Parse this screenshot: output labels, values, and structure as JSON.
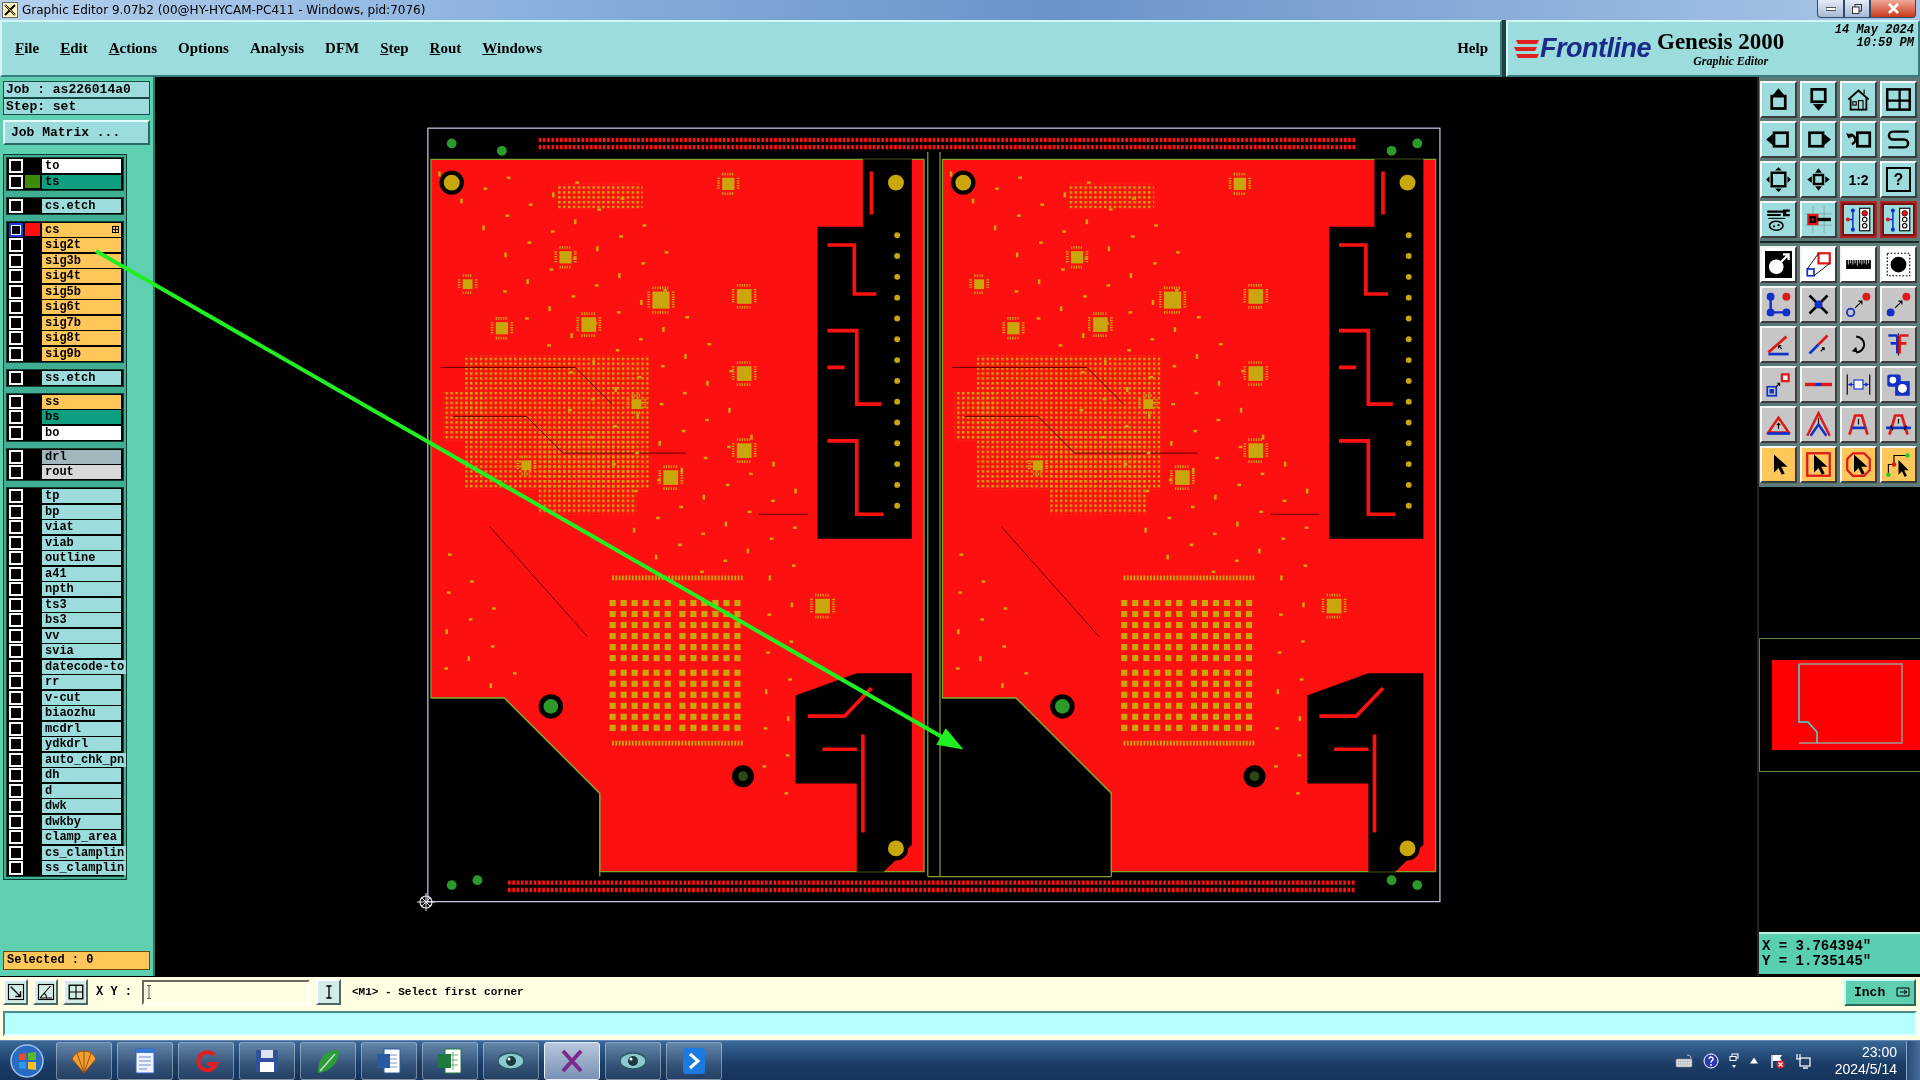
{
  "window": {
    "title": "Graphic Editor 9.07b2 (00@HY-HYCAM-PC411 - Windows, pid:7076)"
  },
  "menu": {
    "items": [
      {
        "label": "File",
        "mnemonic": true
      },
      {
        "label": "Edit",
        "mnemonic": true
      },
      {
        "label": "Actions",
        "mnemonic": true
      },
      {
        "label": "Options",
        "mnemonic": false
      },
      {
        "label": "Analysis",
        "mnemonic": false
      },
      {
        "label": "DFM",
        "mnemonic": false
      },
      {
        "label": "Step",
        "mnemonic": true
      },
      {
        "label": "Rout",
        "mnemonic": true
      },
      {
        "label": "Windows",
        "mnemonic": true
      }
    ],
    "help": "Help"
  },
  "brand": {
    "logo": "Frontline",
    "product": "Genesis 2000",
    "subtitle": "Graphic Editor",
    "date": "14 May 2024",
    "time": "10:59 PM"
  },
  "job": {
    "job": "Job : as226014a0",
    "step": "Step: set",
    "matrix_button": "Job Matrix ..."
  },
  "layer_groups": [
    {
      "layers": [
        {
          "name": "to",
          "color": "#ffffff",
          "work": false
        },
        {
          "name": "ts",
          "color": "#0e9e80",
          "display": {
            "color": "#3c8c0a"
          },
          "work": false
        }
      ]
    },
    {
      "layers": [
        {
          "name": "cs.etch",
          "color": "#9ddcdc",
          "work": false
        }
      ]
    },
    {
      "layers": [
        {
          "name": "cs",
          "color": "#ffc65a",
          "display": {
            "color": "#ff1010"
          },
          "work": true
        },
        {
          "name": "sig2t",
          "color": "#ffc65a",
          "work": false
        },
        {
          "name": "sig3b",
          "color": "#ffc65a",
          "work": false
        },
        {
          "name": "sig4t",
          "color": "#ffc65a",
          "work": false
        },
        {
          "name": "sig5b",
          "color": "#ffc65a",
          "work": false
        },
        {
          "name": "sig6t",
          "color": "#ffc65a",
          "work": false
        },
        {
          "name": "sig7b",
          "color": "#ffc65a",
          "work": false
        },
        {
          "name": "sig8t",
          "color": "#ffc65a",
          "work": false
        },
        {
          "name": "sig9b",
          "color": "#ffc65a",
          "work": false
        }
      ]
    },
    {
      "layers": [
        {
          "name": "ss.etch",
          "color": "#9ddcdc",
          "work": false
        }
      ]
    },
    {
      "layers": [
        {
          "name": "ss",
          "color": "#ffc65a",
          "work": false
        },
        {
          "name": "bs",
          "color": "#0e9e80",
          "work": false
        },
        {
          "name": "bo",
          "color": "#ffffff",
          "work": false
        }
      ]
    },
    {
      "layers": [
        {
          "name": "drl",
          "color": "#a2b6be",
          "work": false
        },
        {
          "name": "rout",
          "color": "#d8d8d8",
          "work": false
        }
      ]
    },
    {
      "layers": [
        {
          "name": "tp",
          "color": "#9ddcdc",
          "work": false
        },
        {
          "name": "bp",
          "color": "#9ddcdc",
          "work": false
        },
        {
          "name": "viat",
          "color": "#9ddcdc",
          "work": false
        },
        {
          "name": "viab",
          "color": "#9ddcdc",
          "work": false
        },
        {
          "name": "outline",
          "color": "#9ddcdc",
          "work": false
        },
        {
          "name": "a41",
          "color": "#9ddcdc",
          "work": false
        },
        {
          "name": "npth",
          "color": "#9ddcdc",
          "work": false
        },
        {
          "name": "ts3",
          "color": "#9ddcdc",
          "work": false
        },
        {
          "name": "bs3",
          "color": "#9ddcdc",
          "work": false
        },
        {
          "name": "vv",
          "color": "#9ddcdc",
          "work": false
        },
        {
          "name": "svia",
          "color": "#9ddcdc",
          "work": false
        },
        {
          "name": "datecode-to",
          "color": "#9ddcdc",
          "work": false
        },
        {
          "name": "rr",
          "color": "#9ddcdc",
          "work": false
        },
        {
          "name": "v-cut",
          "color": "#9ddcdc",
          "work": false
        },
        {
          "name": "biaozhu",
          "color": "#9ddcdc",
          "work": false
        },
        {
          "name": "mcdrl",
          "color": "#9ddcdc",
          "work": false
        },
        {
          "name": "ydkdrl",
          "color": "#9ddcdc",
          "work": false
        },
        {
          "name": "auto_chk_pn",
          "color": "#9ddcdc",
          "work": false
        },
        {
          "name": "dh",
          "color": "#9ddcdc",
          "work": false
        },
        {
          "name": "d",
          "color": "#9ddcdc",
          "work": false
        },
        {
          "name": "dwk",
          "color": "#9ddcdc",
          "work": false
        },
        {
          "name": "dwkby",
          "color": "#9ddcdc",
          "work": false
        },
        {
          "name": "clamp_area",
          "color": "#9ddcdc",
          "work": false
        },
        {
          "name": "cs_clamplin",
          "color": "#9ddcdc",
          "work": false
        },
        {
          "name": "ss_clamplin",
          "color": "#9ddcdc",
          "work": false
        }
      ]
    }
  ],
  "selected_count": "Selected : 0",
  "tool_groups": [
    {
      "kind": "view",
      "buttons": [
        {
          "kind": "panup",
          "active": false
        },
        {
          "kind": "pandown",
          "active": false
        },
        {
          "kind": "home",
          "active": false
        },
        {
          "kind": "grid",
          "active": false
        },
        {
          "kind": "panleft",
          "active": false
        },
        {
          "kind": "panright",
          "active": false
        },
        {
          "kind": "zoomback",
          "active": false
        },
        {
          "kind": "snake",
          "active": false
        },
        {
          "kind": "fit",
          "active": false
        },
        {
          "kind": "zoom",
          "active": false
        },
        {
          "kind": "text",
          "label": "1:2",
          "active": false
        },
        {
          "kind": "help",
          "label": "?",
          "active": false
        },
        {
          "kind": "tools",
          "active": false
        },
        {
          "kind": "pad",
          "active": false
        },
        {
          "kind": "netlist",
          "active": true
        },
        {
          "kind": "netlist",
          "active": true
        }
      ]
    },
    {
      "kind": "measure",
      "buttons": [
        {
          "kind": "feature",
          "active": false
        },
        {
          "kind": "copy",
          "active": false
        },
        {
          "kind": "ruler",
          "active": false
        },
        {
          "kind": "paddot",
          "active": false
        }
      ]
    },
    {
      "kind": "edit",
      "buttons": [
        {
          "kind": "connect",
          "active": false
        },
        {
          "kind": "delete",
          "active": false
        },
        {
          "kind": "moveopen",
          "active": false
        },
        {
          "kind": "move",
          "active": false
        },
        {
          "kind": "angle",
          "active": false
        },
        {
          "kind": "line",
          "active": false
        },
        {
          "kind": "rotate",
          "active": false
        },
        {
          "kind": "mirror",
          "active": false
        },
        {
          "kind": "scale",
          "active": false
        },
        {
          "kind": "segment",
          "active": false
        },
        {
          "kind": "dimension",
          "active": false
        },
        {
          "kind": "shapes",
          "active": false
        },
        {
          "kind": "triangle",
          "active": false
        },
        {
          "kind": "peak",
          "active": false
        },
        {
          "kind": "arch",
          "active": false
        },
        {
          "kind": "archline",
          "active": false
        }
      ]
    },
    {
      "kind": "select",
      "buttons": [
        {
          "kind": "select",
          "active": false
        },
        {
          "kind": "selectbox",
          "active": false
        },
        {
          "kind": "selectpoly",
          "active": false
        },
        {
          "kind": "selectnet",
          "active": false
        }
      ]
    }
  ],
  "coordinates": {
    "x": "X = 3.764394\"",
    "y": "Y = 1.735145\""
  },
  "status": {
    "xy_label": "X Y :",
    "message": "<M1> - Select first corner",
    "units": "Inch"
  },
  "taskbar": {
    "apps": [
      {
        "kind": "shell",
        "selected": false
      },
      {
        "kind": "notepad",
        "selected": false
      },
      {
        "kind": "swirl",
        "selected": false
      },
      {
        "kind": "floppy",
        "selected": false
      },
      {
        "kind": "leaf",
        "selected": false
      },
      {
        "kind": "doc",
        "selected": false
      },
      {
        "kind": "sheet",
        "selected": false
      },
      {
        "kind": "eye",
        "selected": false
      },
      {
        "kind": "cross",
        "selected": true
      },
      {
        "kind": "eye",
        "selected": false
      },
      {
        "kind": "arrow",
        "selected": false
      }
    ],
    "time": "23:00",
    "date": "2024/5/14"
  }
}
